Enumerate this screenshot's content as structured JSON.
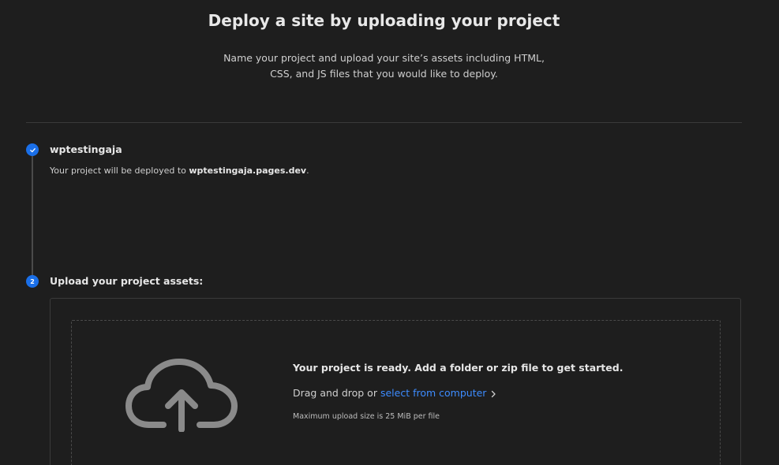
{
  "header": {
    "title": "Deploy a site by uploading your project",
    "subtitle": "Name your project and upload your site’s assets including HTML, CSS, and JS files that you would like to deploy."
  },
  "steps": [
    {
      "status": "complete",
      "icon": "check-icon",
      "title": "wptestingaja",
      "note_prefix": "Your project will be deployed to ",
      "note_domain": "wptestingaja.pages.dev",
      "note_suffix": "."
    },
    {
      "status": "active",
      "number": "2",
      "title": "Upload your project assets:"
    }
  ],
  "upload": {
    "icon": "cloud-upload-icon",
    "ready_text": "Your project is ready. Add a folder or zip file to get started.",
    "drag_text": "Drag and drop or",
    "select_link": "select from computer",
    "max_size_text": "Maximum upload size is 25 MiB per file"
  },
  "colors": {
    "background": "#1e1e1e",
    "accent": "#1a6fe8",
    "link": "#3d8cff",
    "border": "#3a3a3a"
  }
}
